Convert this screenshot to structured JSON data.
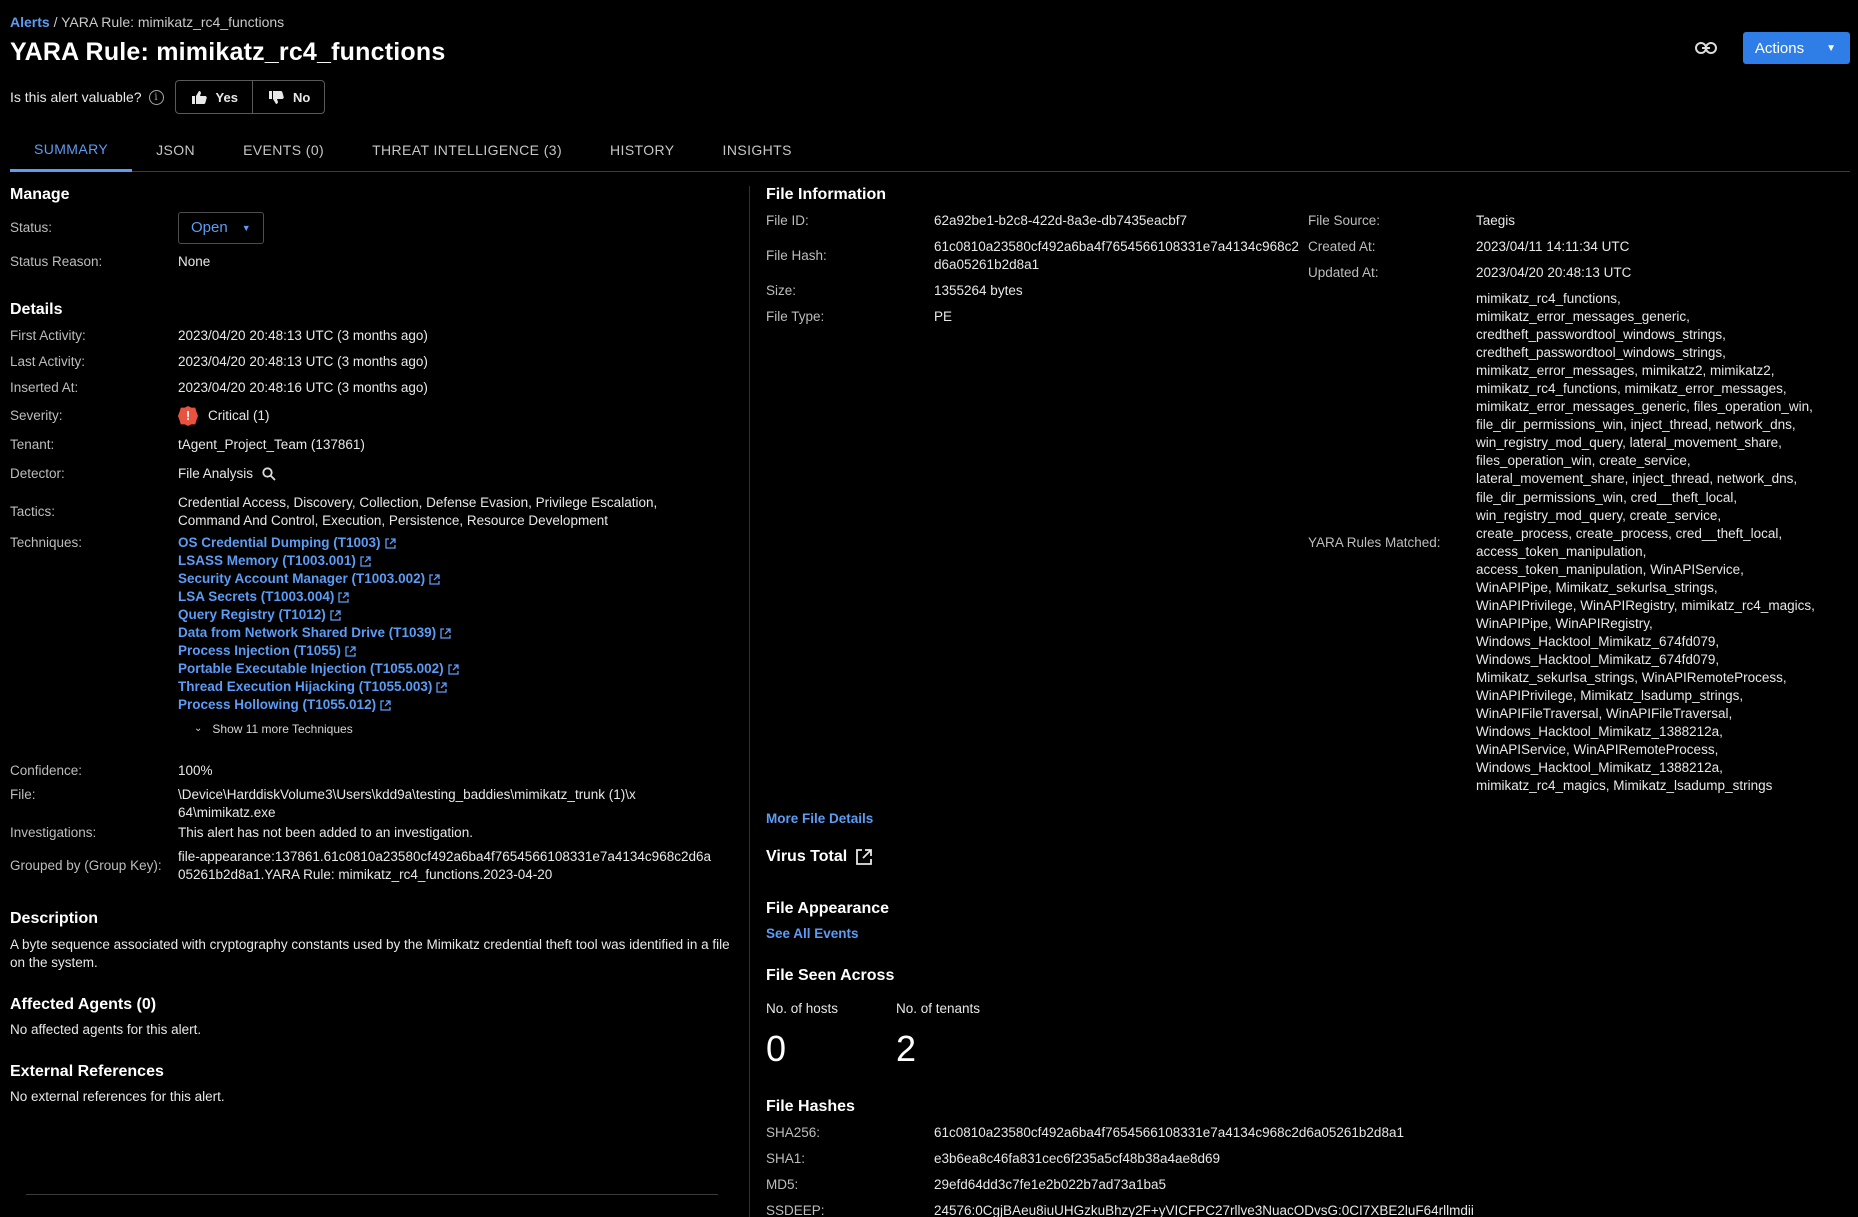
{
  "breadcrumb": {
    "root": "Alerts",
    "separator": " / ",
    "current": "YARA Rule: mimikatz_rc4_functions"
  },
  "page_title": "YARA Rule: mimikatz_rc4_functions",
  "actions_label": "Actions",
  "valuable": {
    "question": "Is this alert valuable?",
    "yes": "Yes",
    "no": "No"
  },
  "tabs": [
    {
      "label": "SUMMARY",
      "active": true
    },
    {
      "label": "JSON"
    },
    {
      "label": "EVENTS (0)"
    },
    {
      "label": "THREAT INTELLIGENCE (3)"
    },
    {
      "label": "HISTORY"
    },
    {
      "label": "INSIGHTS"
    }
  ],
  "manage": {
    "title": "Manage",
    "status_label": "Status:",
    "status_value": "Open",
    "status_reason_label": "Status Reason:",
    "status_reason_value": "None"
  },
  "details": {
    "title": "Details",
    "first_activity_label": "First Activity:",
    "first_activity": "2023/04/20 20:48:13 UTC (3 months ago)",
    "last_activity_label": "Last Activity:",
    "last_activity": "2023/04/20 20:48:13 UTC (3 months ago)",
    "inserted_at_label": "Inserted At:",
    "inserted_at": "2023/04/20 20:48:16 UTC (3 months ago)",
    "severity_label": "Severity:",
    "severity": "Critical (1)",
    "severity_icon": "!",
    "tenant_label": "Tenant:",
    "tenant": "tAgent_Project_Team (137861)",
    "detector_label": "Detector:",
    "detector": "File Analysis",
    "tactics_label": "Tactics:",
    "tactics": "Credential Access, Discovery, Collection, Defense Evasion, Privilege Escalation, Command And Control, Execution, Persistence, Resource Development",
    "techniques_label": "Techniques:",
    "techniques": [
      "OS Credential Dumping (T1003)",
      "LSASS Memory (T1003.001)",
      "Security Account Manager (T1003.002)",
      "LSA Secrets (T1003.004)",
      "Query Registry (T1012)",
      "Data from Network Shared Drive (T1039)",
      "Process Injection (T1055)",
      "Portable Executable Injection (T1055.002)",
      "Thread Execution Hijacking (T1055.003)",
      "Process Hollowing (T1055.012)"
    ],
    "show_more": "Show 11 more Techniques",
    "confidence_label": "Confidence:",
    "confidence": "100%",
    "file_label": "File:",
    "file": "\\Device\\HarddiskVolume3\\Users\\kdd9a\\testing_baddies\\mimikatz_trunk (1)\\x64\\mimikatz.exe",
    "investigations_label": "Investigations:",
    "investigations": "This alert has not been added to an investigation.",
    "group_key_label": "Grouped by (Group Key):",
    "group_key": "file-appearance:137861.61c0810a23580cf492a6ba4f7654566108331e7a4134c968c2d6a05261b2d8a1.YARA Rule: mimikatz_rc4_functions.2023-04-20"
  },
  "description": {
    "title": "Description",
    "text": "A byte sequence associated with cryptography constants used by the Mimikatz credential theft tool was identified in a file on the system."
  },
  "affected_agents": {
    "title": "Affected Agents  (0)",
    "text": "No affected agents for this alert."
  },
  "external_refs": {
    "title": "External References",
    "text": "No external references for this alert."
  },
  "file_info": {
    "title": "File Information",
    "file_id_label": "File ID:",
    "file_id": "62a92be1-b2c8-422d-8a3e-db7435eacbf7",
    "file_hash_label": "File Hash:",
    "file_hash": "61c0810a23580cf492a6ba4f7654566108331e7a4134c968c2d6a05261b2d8a1",
    "size_label": "Size:",
    "size": "1355264 bytes",
    "file_type_label": "File Type:",
    "file_type": "PE",
    "file_source_label": "File Source:",
    "file_source": "Taegis",
    "created_at_label": "Created At:",
    "created_at": "2023/04/11 14:11:34 UTC",
    "updated_at_label": "Updated At:",
    "updated_at": "2023/04/20 20:48:13 UTC",
    "yara_label": "YARA Rules Matched:",
    "yara_matched": "mimikatz_rc4_functions, mimikatz_error_messages_generic, credtheft_passwordtool_windows_strings, credtheft_passwordtool_windows_strings, mimikatz_error_messages, mimikatz2, mimikatz2, mimikatz_rc4_functions, mimikatz_error_messages, mimikatz_error_messages_generic, files_operation_win, file_dir_permissions_win, inject_thread, network_dns, win_registry_mod_query, lateral_movement_share, files_operation_win, create_service, lateral_movement_share, inject_thread, network_dns, file_dir_permissions_win, cred__theft_local, win_registry_mod_query, create_service, create_process, create_process, cred__theft_local, access_token_manipulation, access_token_manipulation, WinAPIService, WinAPIPipe, Mimikatz_sekurlsa_strings, WinAPIPrivilege, WinAPIRegistry, mimikatz_rc4_magics, WinAPIPipe, WinAPIRegistry, Windows_Hacktool_Mimikatz_674fd079, Windows_Hacktool_Mimikatz_674fd079, Mimikatz_sekurlsa_strings, WinAPIRemoteProcess, WinAPIPrivilege, Mimikatz_lsadump_strings, WinAPIFileTraversal, WinAPIFileTraversal, Windows_Hacktool_Mimikatz_1388212a, WinAPIService, WinAPIRemoteProcess, Windows_Hacktool_Mimikatz_1388212a, mimikatz_rc4_magics, Mimikatz_lsadump_strings",
    "more_details": "More File Details"
  },
  "virus_total": "Virus Total",
  "file_appearance": {
    "title": "File Appearance",
    "link": "See All Events"
  },
  "file_seen": {
    "title": "File Seen Across",
    "hosts_label": "No. of hosts",
    "hosts": "0",
    "tenants_label": "No. of tenants",
    "tenants": "2"
  },
  "file_hashes": {
    "title": "File Hashes",
    "sha256_label": "SHA256:",
    "sha256": "61c0810a23580cf492a6ba4f7654566108331e7a4134c968c2d6a05261b2d8a1",
    "sha1_label": "SHA1:",
    "sha1": "e3b6ea8c46fa831cec6f235a5cf48b38a4ae8d69",
    "md5_label": "MD5:",
    "md5": "29efd64dd3c7fe1e2b022b7ad73a1ba5",
    "ssdeep_label": "SSDEEP:",
    "ssdeep": "24576:0CgjBAeu8iuUHGzkuBhzy2F+yVICFPC27rllve3NuacODvsG:0CI7XBE2luF64rllmdii"
  },
  "colors": {
    "accent": "#5b9cf5",
    "button": "#2f7ee8",
    "critical": "#e8523f"
  },
  "icons": [
    "link-icon",
    "info-icon",
    "thumbs-up-icon",
    "thumbs-down-icon",
    "search-icon",
    "external-link-icon",
    "chevron-down-icon",
    "critical-icon"
  ]
}
